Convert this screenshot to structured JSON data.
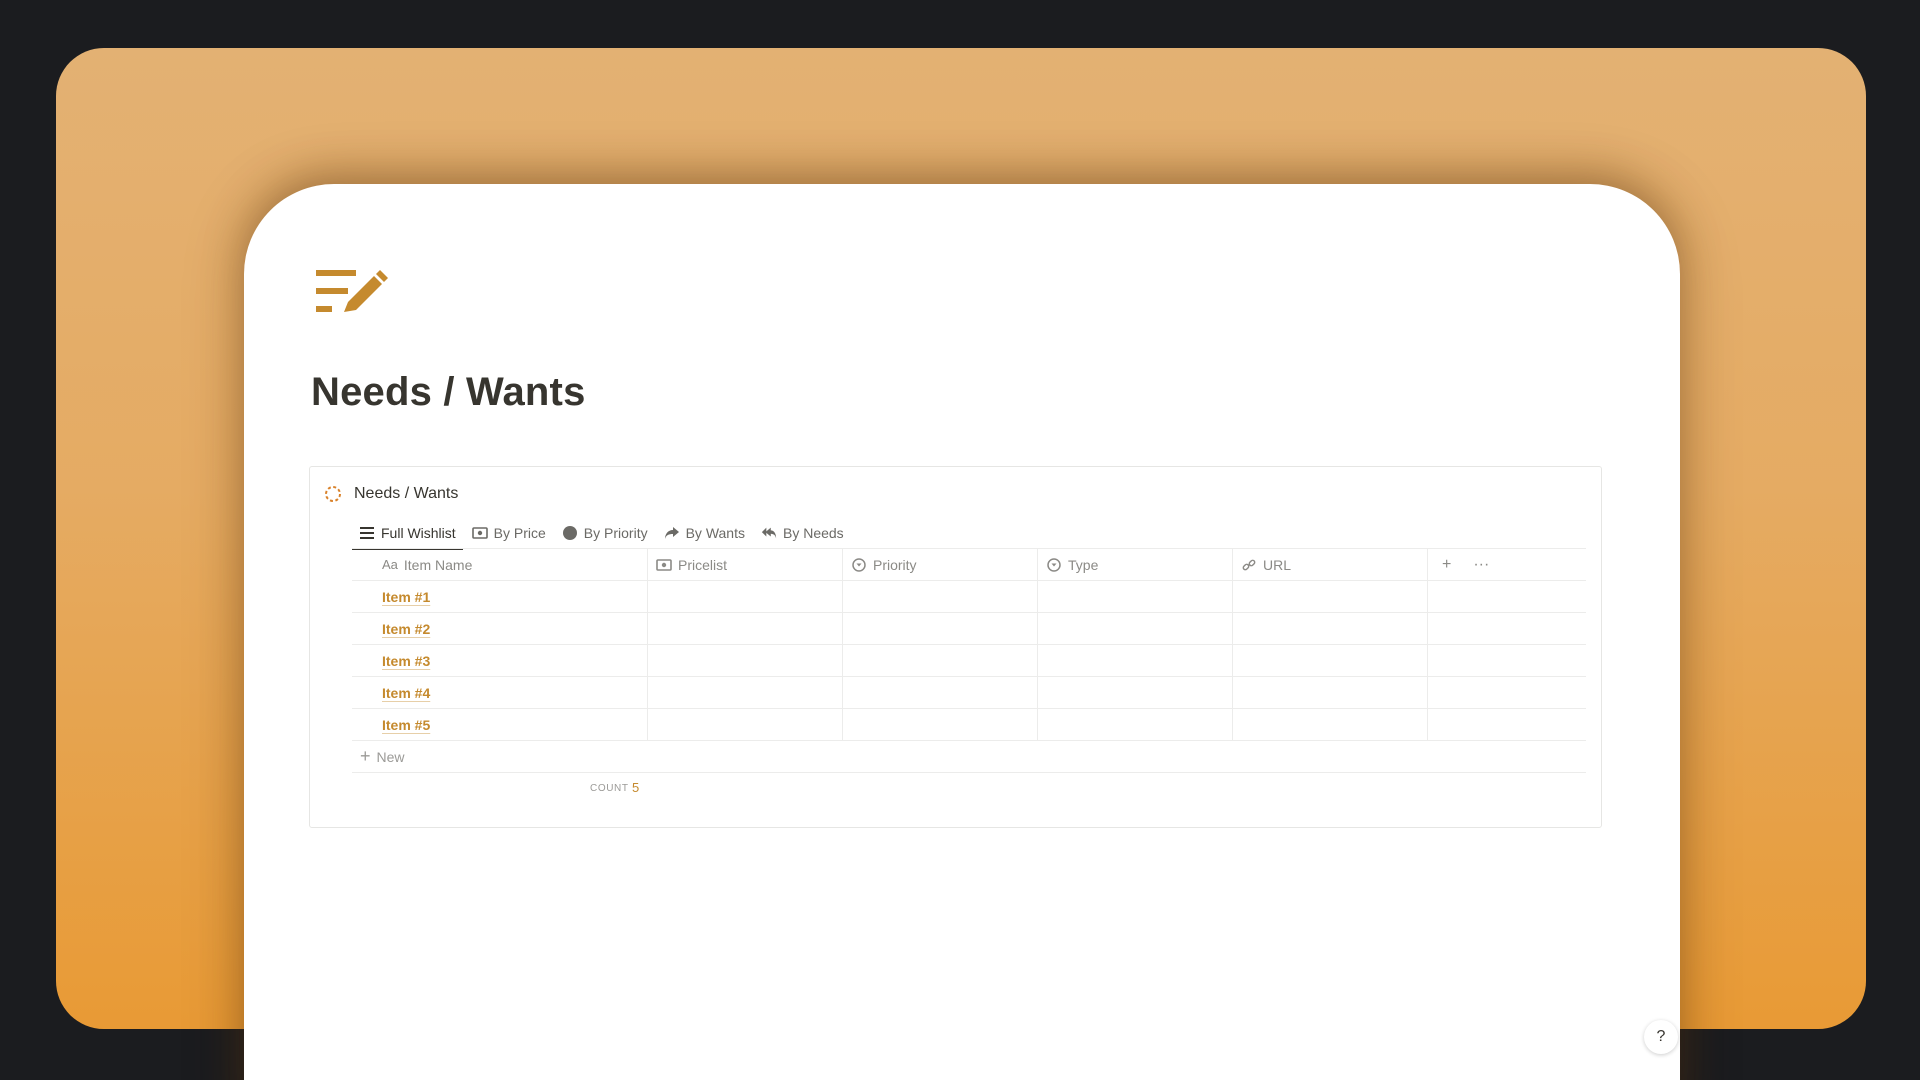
{
  "page": {
    "title": "Needs / Wants",
    "icon": "pencil-list-icon",
    "accent_color": "#c58a2e"
  },
  "database": {
    "title": "Needs / Wants",
    "icon": "dashed-circle-icon",
    "tabs": [
      {
        "label": "Full Wishlist",
        "icon": "list-icon",
        "active": true
      },
      {
        "label": "By Price",
        "icon": "money-icon",
        "active": false
      },
      {
        "label": "By Priority",
        "icon": "circle-icon",
        "active": false
      },
      {
        "label": "By Wants",
        "icon": "share-arrow-icon",
        "active": false
      },
      {
        "label": "By Needs",
        "icon": "double-reply-icon",
        "active": false
      }
    ],
    "columns": [
      {
        "label": "Item Name",
        "icon": "Aa"
      },
      {
        "label": "Pricelist",
        "icon": "money-icon"
      },
      {
        "label": "Priority",
        "icon": "select-icon"
      },
      {
        "label": "Type",
        "icon": "select-icon"
      },
      {
        "label": "URL",
        "icon": "link-icon"
      }
    ],
    "rows": [
      {
        "name": "Item #1"
      },
      {
        "name": "Item #2"
      },
      {
        "name": "Item #3"
      },
      {
        "name": "Item #4"
      },
      {
        "name": "Item #5"
      }
    ],
    "new_label": "New",
    "count_label": "COUNT",
    "count_value": "5"
  },
  "help_label": "?"
}
